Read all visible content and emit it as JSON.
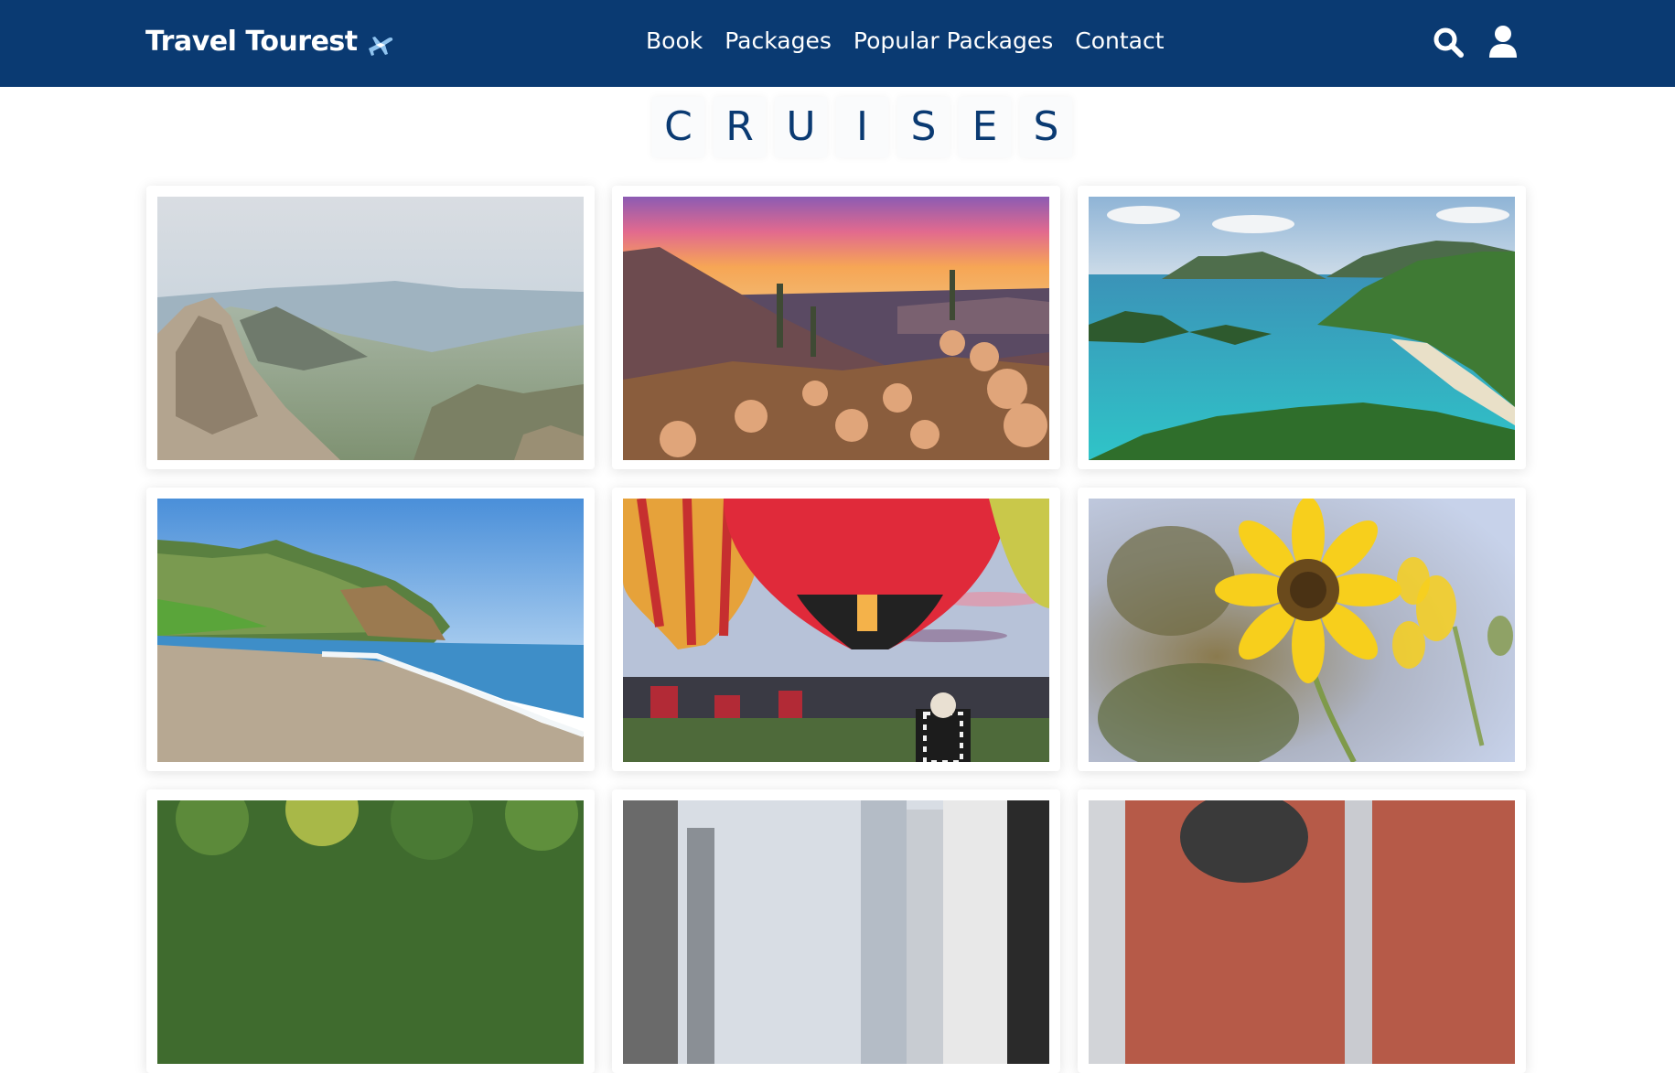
{
  "brand": {
    "name": "Travel Tourest",
    "icon": "airplane-icon"
  },
  "nav": {
    "links": [
      "Book",
      "Packages",
      "Popular Packages",
      "Contact"
    ],
    "icons": [
      "search-icon",
      "user-icon"
    ]
  },
  "page": {
    "heading_letters": [
      "C",
      "R",
      "U",
      "I",
      "S",
      "E",
      "S"
    ]
  },
  "colors": {
    "navbar": "#0a3a72",
    "heading_text": "#0a3a72"
  },
  "gallery": {
    "images": [
      "mountain-valley-photo",
      "desert-sunset-cactus-photo",
      "tropical-bay-photo",
      "beach-hills-photo",
      "hot-air-balloons-photo",
      "sunflower-photo",
      "forest-photo",
      "city-street-photo",
      "statue-photo"
    ]
  }
}
